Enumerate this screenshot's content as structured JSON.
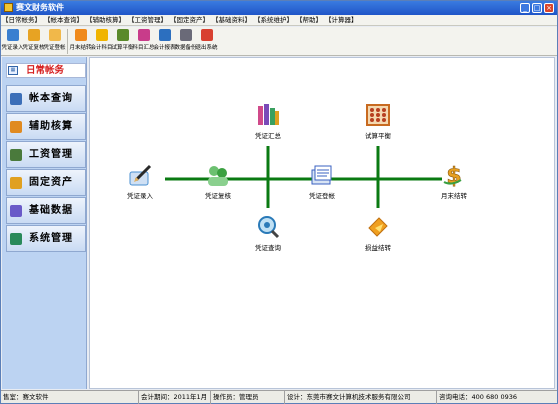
{
  "window": {
    "title": "赛文财务软件"
  },
  "menu": [
    "【日常帐务】",
    "【帐本查询】",
    "【辅助核算】",
    "【工资管理】",
    "【固定资产】",
    "【基础资料】",
    "【系统维护】",
    "【帮助】",
    "【计算器】"
  ],
  "toolbar": [
    {
      "label": "凭证录入",
      "icon": "pen-voucher-icon",
      "color": "#3a7fd0"
    },
    {
      "label": "凭证复核",
      "icon": "check-voucher-icon",
      "color": "#e7a323"
    },
    {
      "label": "凭证登帐",
      "icon": "book-icon",
      "color": "#f1b84a"
    },
    {
      "label": "月末结转",
      "icon": "sync-icon",
      "color": "#f08a1c"
    },
    {
      "label": "会计科目",
      "icon": "ledger-icon",
      "color": "#f0b400"
    },
    {
      "label": "试算平衡",
      "icon": "scale-icon",
      "color": "#5a8a2a"
    },
    {
      "label": "科目汇总",
      "icon": "summary-icon",
      "color": "#c83c8a"
    },
    {
      "label": "会计报表",
      "icon": "report-icon",
      "color": "#2c6fbf"
    },
    {
      "label": "数据备份",
      "icon": "printer-icon",
      "color": "#6a6a78"
    },
    {
      "label": "退出系统",
      "icon": "exit-icon",
      "color": "#d84030"
    }
  ],
  "sidebar": {
    "header": "日常帐务",
    "items": [
      {
        "label": "帐本查询",
        "icon": "book-query-icon",
        "color": "#3c6fb8"
      },
      {
        "label": "辅助核算",
        "icon": "people-icon",
        "color": "#e08a20"
      },
      {
        "label": "工资管理",
        "icon": "money-icon",
        "color": "#4a7a3c"
      },
      {
        "label": "固定资产",
        "icon": "asset-icon",
        "color": "#e0a020"
      },
      {
        "label": "基础数据",
        "icon": "data-icon",
        "color": "#6a5ac8"
      },
      {
        "label": "系统管理",
        "icon": "settings-icon",
        "color": "#2a8a5a"
      }
    ]
  },
  "flow": {
    "line_color": "#0a7a12",
    "nodes": [
      {
        "id": "entry",
        "label": "凭证录入",
        "icon": "pen-icon",
        "color": "#4a8fd0"
      },
      {
        "id": "review",
        "label": "凭证复核",
        "icon": "people-check-icon",
        "color": "#3aa040"
      },
      {
        "id": "summary",
        "label": "凭证汇总",
        "icon": "books-stack-icon",
        "color": "#d04a8a"
      },
      {
        "id": "query",
        "label": "凭证查询",
        "icon": "magnifier-icon",
        "color": "#2a7ab8"
      },
      {
        "id": "post",
        "label": "凭证登帐",
        "icon": "ledger-book-icon",
        "color": "#3a60c0"
      },
      {
        "id": "trial",
        "label": "试算平衡",
        "icon": "abacus-icon",
        "color": "#c86a20"
      },
      {
        "id": "pl",
        "label": "损益结转",
        "icon": "folder-arrow-icon",
        "color": "#f0a020"
      },
      {
        "id": "month",
        "label": "月末结转",
        "icon": "dollar-icon",
        "color": "#e8a020"
      }
    ]
  },
  "status": {
    "user": "售室：赛文软件",
    "period": "会计期间：2011年1月",
    "operator": "操作员：管理员",
    "company": "设计：东莞市赛文计算机技术服务有限公司",
    "phone": "咨询电话：400 680 0936"
  }
}
